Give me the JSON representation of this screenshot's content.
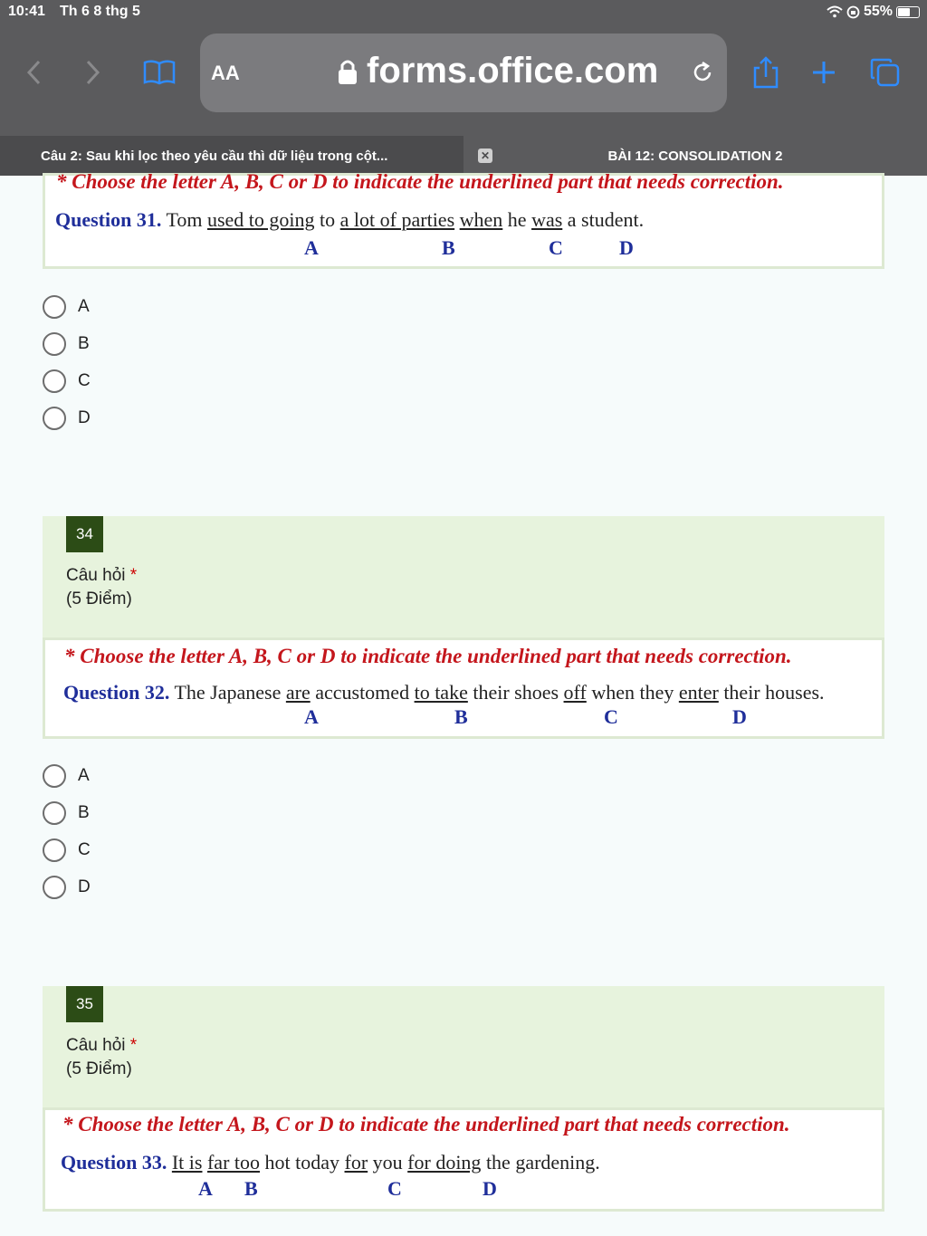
{
  "status": {
    "time": "10:41",
    "date": "Th 6 8 thg 5",
    "battery": "55%"
  },
  "browser": {
    "text_size": "AA",
    "url": "forms.office.com"
  },
  "tabs": [
    {
      "label": "Câu 2: Sau khi lọc theo yêu cầu thì dữ liệu trong cột..."
    },
    {
      "label": "BÀI 12: CONSOLIDATION 2"
    }
  ],
  "q31": {
    "instruction": "* Choose the letter A, B, C or D to indicate the underlined part that needs correction.",
    "question_no": "Question 31.",
    "parts": [
      "Tom ",
      "used to going",
      " to ",
      "a lot of parties",
      " ",
      "when",
      " he ",
      "was",
      " a student."
    ],
    "letters": [
      "A",
      "B",
      "C",
      "D"
    ],
    "options": [
      "A",
      "B",
      "C",
      "D"
    ]
  },
  "q34": {
    "number": "34",
    "label": "Câu hỏi",
    "required": "*",
    "points": "(5 Điểm)",
    "instruction": "* Choose the letter A, B, C or D to indicate the underlined part that needs correction.",
    "question_no": "Question 32.",
    "parts": [
      " The Japanese ",
      "are",
      " accustomed ",
      "to take",
      " their shoes ",
      "off",
      " when they ",
      "enter",
      " their houses."
    ],
    "letters": [
      "A",
      "B",
      "C",
      "D"
    ],
    "options": [
      "A",
      "B",
      "C",
      "D"
    ]
  },
  "q35": {
    "number": "35",
    "label": "Câu hỏi",
    "required": "*",
    "points": "(5 Điểm)",
    "instruction": "* Choose the letter A, B, C or D to indicate the underlined part that needs correction.",
    "question_no": "Question 33.",
    "parts": [
      " ",
      "It is",
      " ",
      "far too",
      " hot today ",
      "for",
      " you ",
      "for doing",
      " the gardening."
    ],
    "letters": [
      "A",
      "B",
      "C",
      "D"
    ]
  }
}
